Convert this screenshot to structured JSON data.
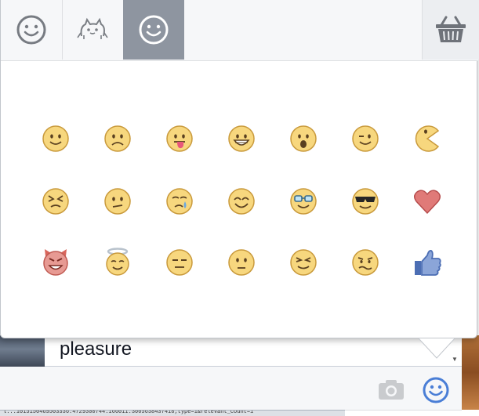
{
  "composer": {
    "message_text": "pleasure",
    "status_text": "l...1015150469503336.4729300744.166011.3005638437418;type=1&relevant_count=1"
  },
  "tabs": [
    {
      "name": "tab-emoticons",
      "icon": "smiley-outline-icon"
    },
    {
      "name": "tab-stickers-cat",
      "icon": "cat-sticker-icon"
    },
    {
      "name": "tab-emoji-active",
      "icon": "smiley-outline-icon",
      "active": true
    },
    {
      "name": "sticker-store",
      "icon": "basket-icon"
    }
  ],
  "emoticons": [
    {
      "row": 0,
      "col": 0,
      "icon": "smile-emoticon-icon"
    },
    {
      "row": 0,
      "col": 1,
      "icon": "frown-emoticon-icon"
    },
    {
      "row": 0,
      "col": 2,
      "icon": "tongue-emoticon-icon"
    },
    {
      "row": 0,
      "col": 3,
      "icon": "grin-emoticon-icon"
    },
    {
      "row": 0,
      "col": 4,
      "icon": "gasp-emoticon-icon"
    },
    {
      "row": 0,
      "col": 5,
      "icon": "wink-emoticon-icon"
    },
    {
      "row": 0,
      "col": 6,
      "icon": "pacman-emoticon-icon"
    },
    {
      "row": 1,
      "col": 0,
      "icon": "squint-emoticon-icon"
    },
    {
      "row": 1,
      "col": 1,
      "icon": "confused-emoticon-icon"
    },
    {
      "row": 1,
      "col": 2,
      "icon": "cry-emoticon-icon"
    },
    {
      "row": 1,
      "col": 3,
      "icon": "kiki-emoticon-icon"
    },
    {
      "row": 1,
      "col": 4,
      "icon": "glasses-emoticon-icon"
    },
    {
      "row": 1,
      "col": 5,
      "icon": "sunglasses-emoticon-icon"
    },
    {
      "row": 1,
      "col": 6,
      "icon": "heart-emoticon-icon"
    },
    {
      "row": 2,
      "col": 0,
      "icon": "devil-emoticon-icon"
    },
    {
      "row": 2,
      "col": 1,
      "icon": "angel-emoticon-icon"
    },
    {
      "row": 2,
      "col": 2,
      "icon": "unsure-emoticon-icon"
    },
    {
      "row": 2,
      "col": 3,
      "icon": "straight-face-emoticon-icon"
    },
    {
      "row": 2,
      "col": 4,
      "icon": "closed-eyes-emoticon-icon"
    },
    {
      "row": 2,
      "col": 5,
      "icon": "grumpy-emoticon-icon"
    },
    {
      "row": 2,
      "col": 6,
      "icon": "like-thumb-icon"
    }
  ],
  "colors": {
    "face_fill": "#f7d77e",
    "face_stroke": "#c99a3c",
    "heart": "#e07a78",
    "thumb": "#4c6eb4",
    "devil": "#e79a93",
    "accent": "#4a7ed6"
  }
}
